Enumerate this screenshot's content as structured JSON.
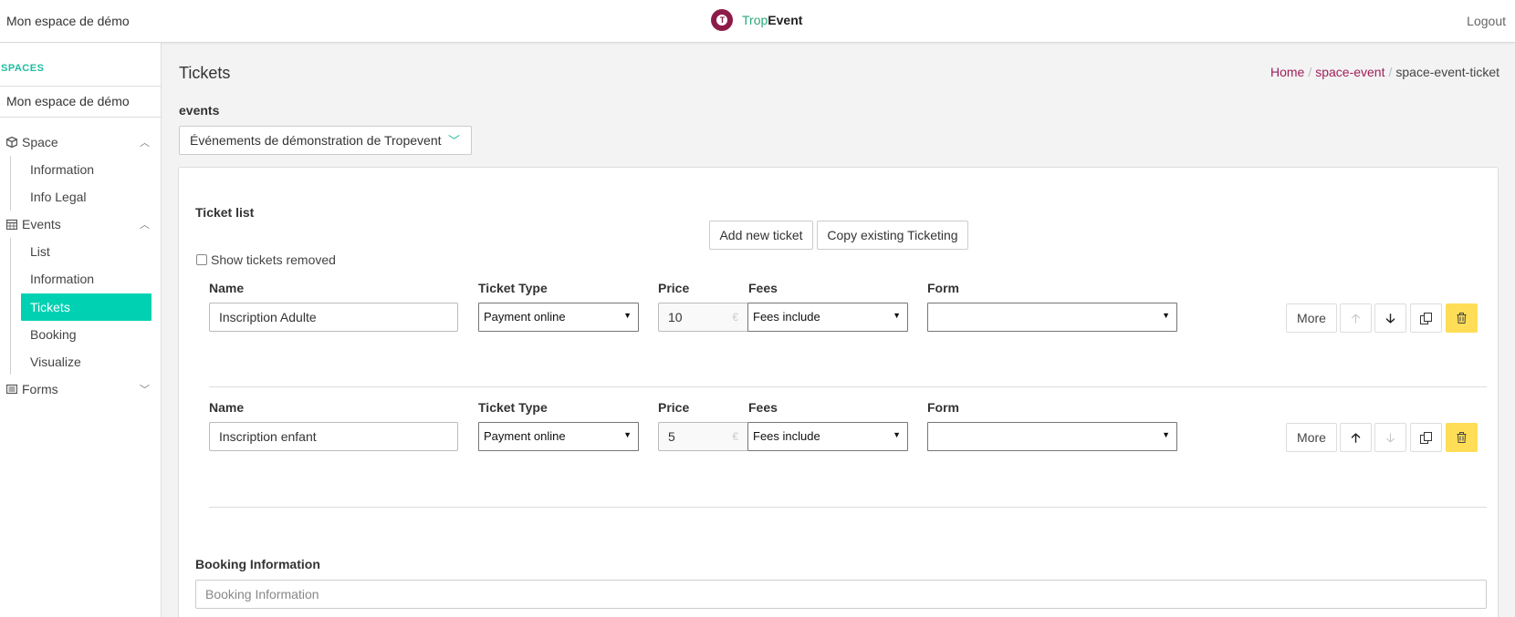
{
  "header": {
    "space_name": "Mon espace de démo",
    "brand_logo_letter": "T",
    "brand_part1": "Trop",
    "brand_part2": "Event",
    "logout_label": "Logout"
  },
  "sidebar": {
    "spaces_label": "SPACES",
    "current_space": "Mon espace de démo",
    "groups": [
      {
        "label": "Space",
        "icon": "cube-icon",
        "expanded": true,
        "items": [
          "Information",
          "Info Legal"
        ]
      },
      {
        "label": "Events",
        "icon": "calendar-icon",
        "expanded": true,
        "items": [
          "List",
          "Information",
          "Tickets",
          "Booking",
          "Visualize"
        ]
      },
      {
        "label": "Forms",
        "icon": "list-icon",
        "expanded": false,
        "items": []
      }
    ],
    "active_item": "Tickets"
  },
  "page": {
    "title": "Tickets",
    "breadcrumb": [
      "Home",
      "space-event",
      "space-event-ticket"
    ],
    "events_label": "events",
    "event_selected": "Événements de démonstration de Tropevent"
  },
  "ticket_list": {
    "title": "Ticket list",
    "add_button": "Add new ticket",
    "copy_button": "Copy existing Ticketing",
    "show_removed_label": "Show tickets removed",
    "columns": {
      "name": "Name",
      "type": "Ticket Type",
      "price": "Price",
      "fees": "Fees",
      "form": "Form"
    },
    "currency_symbol": "€",
    "more_label": "More",
    "tickets": [
      {
        "name": "Inscription Adulte",
        "type": "Payment online",
        "price": "10",
        "fees": "Fees include",
        "form": ""
      },
      {
        "name": "Inscription enfant",
        "type": "Payment online",
        "price": "5",
        "fees": "Fees include",
        "form": ""
      }
    ]
  },
  "booking": {
    "label": "Booking Information",
    "placeholder": "Booking Information"
  },
  "colors": {
    "accent": "#00d1b2",
    "brand": "#8d1b4a",
    "link": "#a0205a",
    "danger": "#ffdd57"
  }
}
